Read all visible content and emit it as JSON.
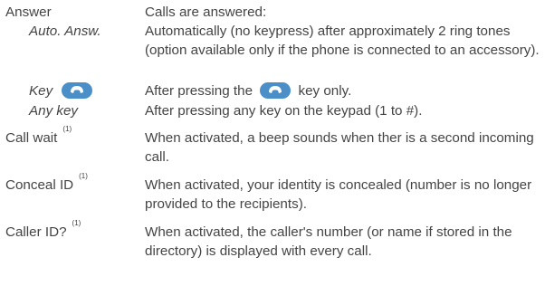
{
  "rows": [
    {
      "term": "Answer",
      "desc": "Calls are answered:"
    },
    {
      "term": "Auto. Answ.",
      "desc": "Automatically (no keypress) after approximately 2 ring tones (option available only if the phone is connected to an accessory)."
    },
    {
      "term": "Key",
      "desc_pre": "After pressing the",
      "desc_post": "key only."
    },
    {
      "term": "Any key",
      "desc": "After pressing any key on the keypad (1 to #)."
    },
    {
      "term": "Call wait",
      "note": "(1)",
      "desc": "When activated, a beep sounds when ther is a second incoming call."
    },
    {
      "term": "Conceal ID",
      "note": "(1)",
      "desc": "When activated, your identity is concealed (number is no longer provided to the recipients)."
    },
    {
      "term": "Caller ID?",
      "note": "(1)",
      "desc": "When activated, the caller's number (or name if stored in the directory) is displayed with every call."
    }
  ],
  "icons": {
    "call_key": "phone-handset-icon",
    "call_key_color": "#4a8fc8"
  }
}
